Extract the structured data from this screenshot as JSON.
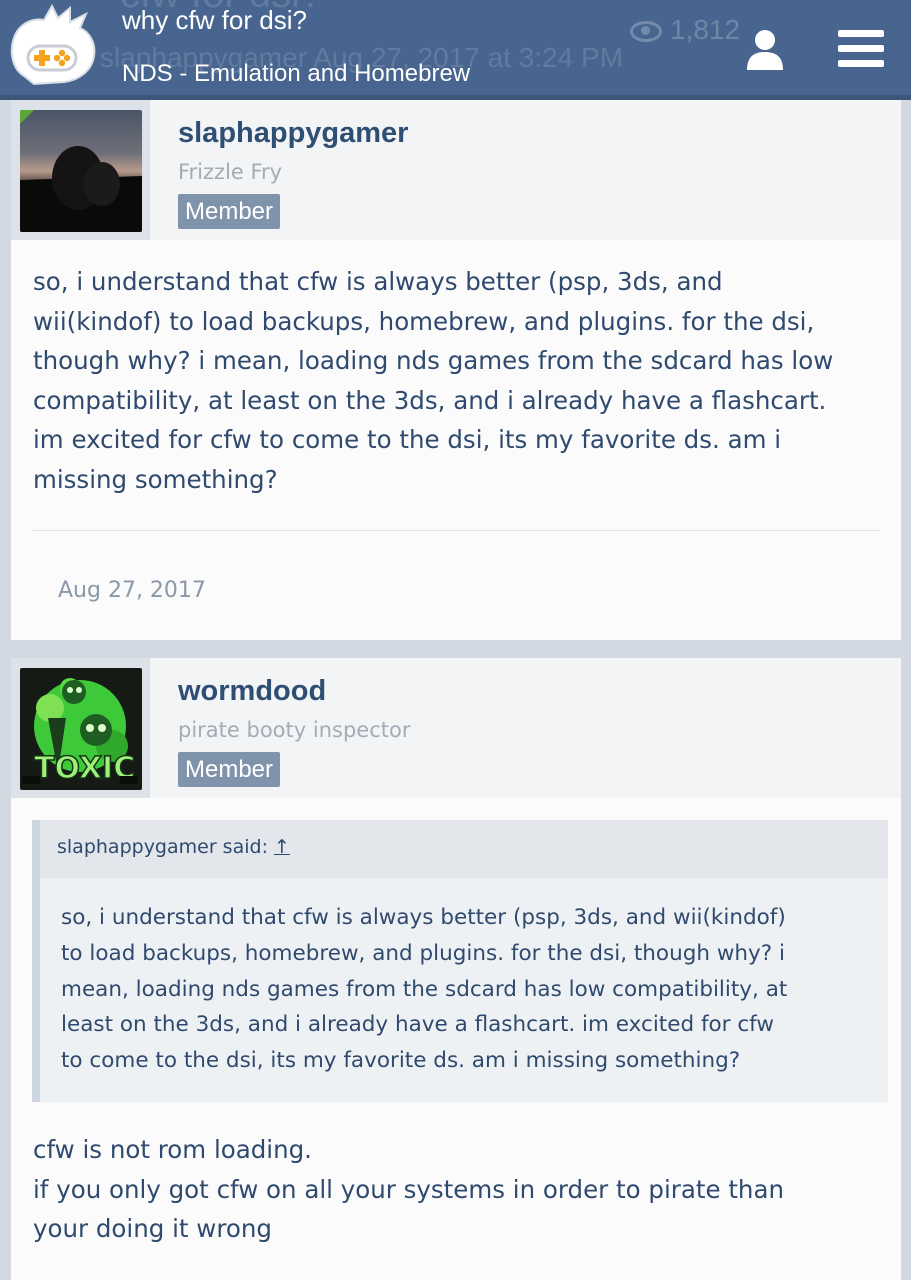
{
  "header": {
    "thread_title": "why cfw for dsi?",
    "forum_name": "NDS - Emulation and Homebrew",
    "ghost_title": "cfw for dsi?",
    "ghost_meta": "slaphappygamer Aug 27, 2017 at 3:24 PM",
    "ghost_views": "1,812",
    "icons": [
      "gamepad-logo-icon",
      "user-icon",
      "menu-icon"
    ],
    "colors": {
      "bar": "#47658f",
      "text": "#ffffff",
      "logo_plus": "#f5a31c"
    }
  },
  "posts": [
    {
      "username": "slaphappygamer",
      "user_title": "Frizzle Fry",
      "badge": "Member",
      "lines": [
        "so, i understand that cfw is always better (psp, 3ds, and",
        "wii(kindof) to load backups, homebrew, and plugins. for the dsi,",
        "though why? i mean, loading nds games from the sdcard has low",
        "compatibility, at least on the 3ds, and i already have a flashcart.",
        "im excited for cfw to come to the dsi, its my favorite ds. am i",
        "missing something?"
      ],
      "date": "Aug 27, 2017"
    },
    {
      "username": "wormdood",
      "user_title": "pirate booty inspector",
      "badge": "Member",
      "quote": {
        "author": "slaphappygamer said:",
        "arrow": "↑",
        "lines": [
          "so, i understand that cfw is always better (psp, 3ds, and wii(kindof)",
          "to load backups, homebrew, and plugins. for the dsi, though why? i",
          "mean, loading nds games from the sdcard has low compatibility, at",
          "least on the 3ds, and i already have a flashcart. im excited for cfw",
          "to come to the dsi, its my favorite ds. am i missing something?"
        ]
      },
      "lines": [
        "cfw is not rom loading.",
        "if you only got cfw on all your systems in order to pirate than",
        "your doing it wrong"
      ]
    }
  ]
}
